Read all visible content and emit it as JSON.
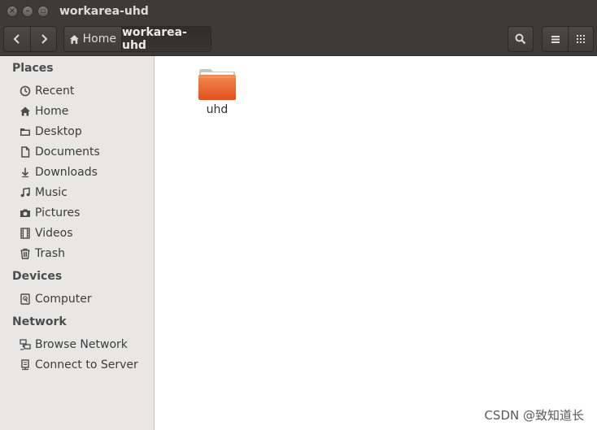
{
  "window": {
    "title": "workarea-uhd"
  },
  "toolbar": {
    "breadcrumb_home": "Home",
    "breadcrumb_current": "workarea-uhd"
  },
  "sidebar": {
    "places_title": "Places",
    "places": [
      {
        "label": "Recent",
        "icon": "clock-icon"
      },
      {
        "label": "Home",
        "icon": "home-icon"
      },
      {
        "label": "Desktop",
        "icon": "folder-icon"
      },
      {
        "label": "Documents",
        "icon": "document-icon"
      },
      {
        "label": "Downloads",
        "icon": "download-icon"
      },
      {
        "label": "Music",
        "icon": "music-icon"
      },
      {
        "label": "Pictures",
        "icon": "camera-icon"
      },
      {
        "label": "Videos",
        "icon": "film-icon"
      },
      {
        "label": "Trash",
        "icon": "trash-icon"
      }
    ],
    "devices_title": "Devices",
    "devices": [
      {
        "label": "Computer",
        "icon": "drive-icon"
      }
    ],
    "network_title": "Network",
    "network": [
      {
        "label": "Browse Network",
        "icon": "network-icon"
      },
      {
        "label": "Connect to Server",
        "icon": "server-icon"
      }
    ]
  },
  "main": {
    "files": [
      {
        "name": "uhd",
        "type": "folder"
      }
    ]
  },
  "watermark": "CSDN @致知道长",
  "colors": {
    "titlebar": "#3c3b37",
    "folder": "#e9541f",
    "sidebar": "#e8e7e5"
  }
}
